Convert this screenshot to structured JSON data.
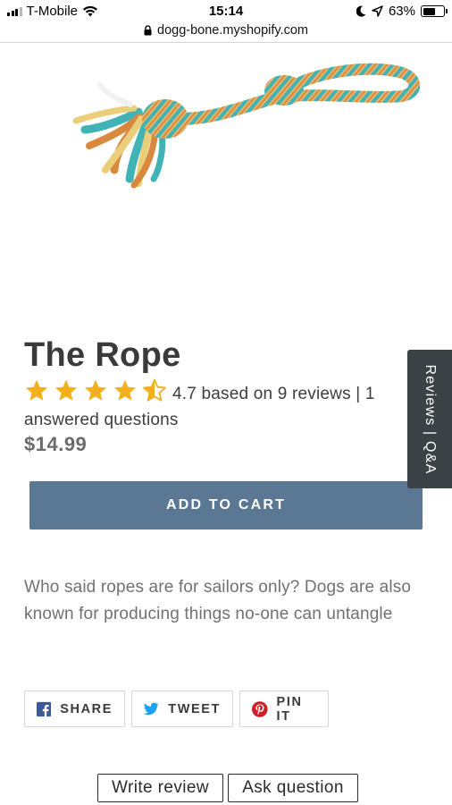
{
  "status_bar": {
    "carrier": "T-Mobile",
    "time": "15:14",
    "battery": "63%",
    "battery_level": 0.63
  },
  "browser": {
    "url": "dogg-bone.myshopify.com"
  },
  "product": {
    "title": "The Rope",
    "rating": 4.7,
    "rating_text": "4.7 based on 9 reviews | 1 answered questions",
    "price": "$14.99",
    "description": "Who said ropes are for sailors only? Dogs are also known for producing things no-one can untangle"
  },
  "buttons": {
    "add_to_cart": "ADD TO CART",
    "reviews_tab": "Reviews | Q&A",
    "write_review": "Write review",
    "ask_question": "Ask question"
  },
  "social": {
    "facebook": "SHARE",
    "twitter": "TWEET",
    "pinterest": "PIN IT"
  },
  "colors": {
    "accent": "#5a7894",
    "star": "#f2b01e",
    "tab": "#3b4245",
    "facebook": "#3b5998",
    "twitter": "#1da1f2",
    "pinterest": "#cb2027"
  },
  "icons": [
    "wifi-icon",
    "moon-icon",
    "location-arrow-icon",
    "lock-icon",
    "star-icon",
    "half-star-icon",
    "facebook-icon",
    "twitter-icon",
    "pinterest-icon"
  ]
}
